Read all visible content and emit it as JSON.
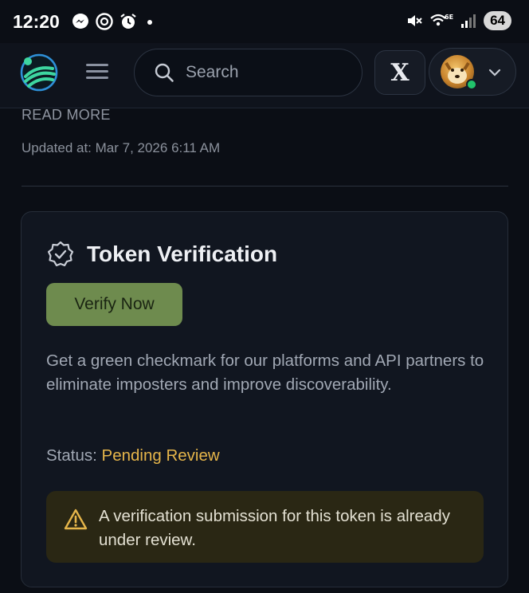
{
  "status_bar": {
    "time": "12:20",
    "battery": "64",
    "left_icons": [
      "messenger-icon",
      "threads-icon",
      "alarm-icon",
      "dot-icon"
    ],
    "right_icons": [
      "mute-icon",
      "wifi-6e-icon",
      "signal-icon"
    ]
  },
  "header": {
    "search": {
      "placeholder": "Search",
      "value": ""
    },
    "x_button_label": "X",
    "colors": {
      "online": "#21c36b",
      "logo_green": "#3dd6a0",
      "logo_blue": "#2f8fd8"
    }
  },
  "content": {
    "read_more": "READ MORE",
    "updated": "Updated at: Mar 7, 2026 6:11 AM"
  },
  "card": {
    "title": "Token Verification",
    "verify_button": "Verify Now",
    "description": "Get a green checkmark for our platforms and API partners to eliminate imposters and improve discoverability.",
    "status_label": "Status:",
    "status_value": "Pending Review",
    "alert_text": "A verification submission for this token is already under review.",
    "colors": {
      "button": "#6e8b4e",
      "status": "#e5b54a",
      "alert_bg": "#2a2714"
    }
  }
}
